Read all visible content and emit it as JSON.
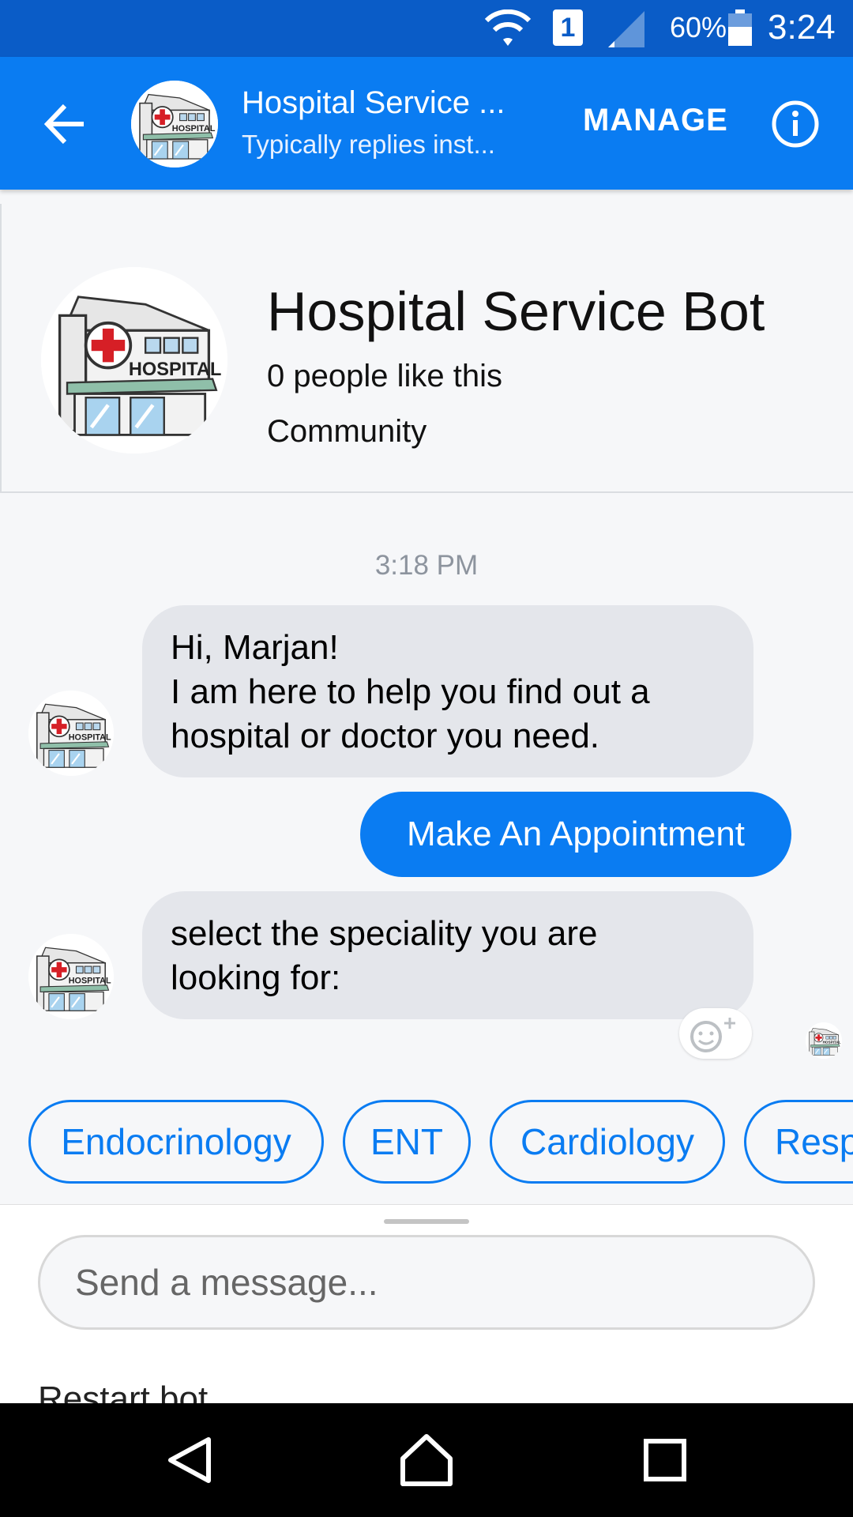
{
  "status_bar": {
    "sim_slot": "1",
    "battery_percent": "60%",
    "time": "3:24",
    "icons": [
      "wifi-icon",
      "sim-icon",
      "signal-icon",
      "battery-icon"
    ]
  },
  "header": {
    "title": "Hospital Service ...",
    "subtitle": "Typically replies inst...",
    "manage_label": "MANAGE",
    "back_icon": "arrow-left-icon",
    "info_icon": "info-icon"
  },
  "profile": {
    "name": "Hospital Service Bot",
    "likes": "0 people like this",
    "category": "Community",
    "avatar_logo_text": "HOSPITAL"
  },
  "conversation": {
    "timestamp": "3:18 PM",
    "messages": [
      {
        "from": "bot",
        "lines": [
          "Hi, Marjan!",
          "I am here to help you find out a",
          "hospital or doctor you need."
        ]
      },
      {
        "from": "user",
        "text": "Make An Appointment"
      },
      {
        "from": "bot",
        "lines": [
          "select the speciality you are",
          "looking for:"
        ]
      }
    ]
  },
  "quick_replies": [
    "Endocrinology",
    "ENT",
    "Cardiology",
    "Resp"
  ],
  "composer": {
    "placeholder": "Send a message...",
    "restart_label": "Restart bot"
  },
  "colors": {
    "status_bar": "#0a5cc7",
    "app_bar": "#0a7cf2",
    "accent": "#0a7cf2",
    "incoming_bubble": "#e4e6eb",
    "background": "#f6f7f9"
  },
  "nav_bar": {
    "icons": [
      "nav-back-icon",
      "nav-home-icon",
      "nav-recent-icon"
    ]
  }
}
